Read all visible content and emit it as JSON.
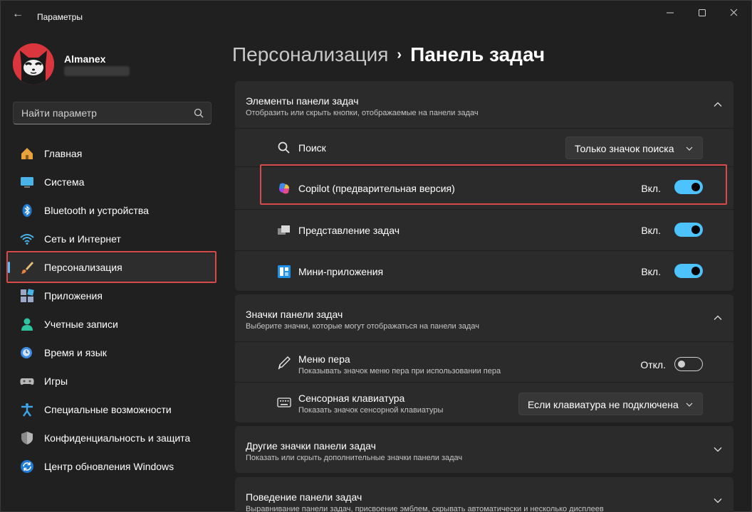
{
  "window": {
    "title": "Параметры",
    "back_glyph": "←",
    "min_glyph": "—",
    "max_glyph": "☐",
    "close_glyph": "✕"
  },
  "user": {
    "name": "Almanex"
  },
  "search": {
    "placeholder": "Найти параметр"
  },
  "sidebar": {
    "items": [
      {
        "label": "Главная",
        "icon": "home-icon"
      },
      {
        "label": "Система",
        "icon": "system-icon"
      },
      {
        "label": "Bluetooth и устройства",
        "icon": "bluetooth-icon"
      },
      {
        "label": "Сеть и Интернет",
        "icon": "wifi-icon"
      },
      {
        "label": "Персонализация",
        "icon": "brush-icon",
        "active": true
      },
      {
        "label": "Приложения",
        "icon": "apps-icon"
      },
      {
        "label": "Учетные записи",
        "icon": "account-icon"
      },
      {
        "label": "Время и язык",
        "icon": "time-language-icon"
      },
      {
        "label": "Игры",
        "icon": "gamepad-icon"
      },
      {
        "label": "Специальные возможности",
        "icon": "accessibility-icon"
      },
      {
        "label": "Конфиденциальность и защита",
        "icon": "shield-icon"
      },
      {
        "label": "Центр обновления Windows",
        "icon": "update-icon"
      }
    ]
  },
  "breadcrumb": {
    "parent": "Персонализация",
    "separator": "›",
    "current": "Панель задач"
  },
  "sections": {
    "taskbar_items": {
      "title": "Элементы панели задач",
      "subtitle": "Отобразить или скрыть кнопки, отображаемые на панели задач",
      "search": {
        "label": "Поиск",
        "value": "Только значок поиска"
      },
      "copilot": {
        "label": "Copilot (предварительная версия)",
        "state": "Вкл."
      },
      "task_view": {
        "label": "Представление задач",
        "state": "Вкл."
      },
      "widgets": {
        "label": "Мини-приложения",
        "state": "Вкл."
      }
    },
    "corner_icons": {
      "title": "Значки панели задач",
      "subtitle": "Выберите значки, которые могут отображаться на панели задач",
      "pen_menu": {
        "label": "Меню пера",
        "desc": "Показывать значок меню пера при использовании пера",
        "state": "Откл."
      },
      "touch_keyboard": {
        "label": "Сенсорная клавиатура",
        "desc": "Показать значок сенсорной клавиатуры",
        "value": "Если клавиатура не подключена"
      }
    },
    "overflow": {
      "title": "Другие значки панели задач",
      "subtitle": "Показать или скрыть дополнительные значки панели задач"
    },
    "behaviors": {
      "title": "Поведение панели задач",
      "subtitle": "Выравнивание панели задач, присвоение эмблем, скрывать автоматически и несколько дисплеев"
    }
  },
  "colors": {
    "accent": "#4cc2ff",
    "highlight": "#d84a4a",
    "background": "#202020",
    "card": "#2b2b2b"
  }
}
